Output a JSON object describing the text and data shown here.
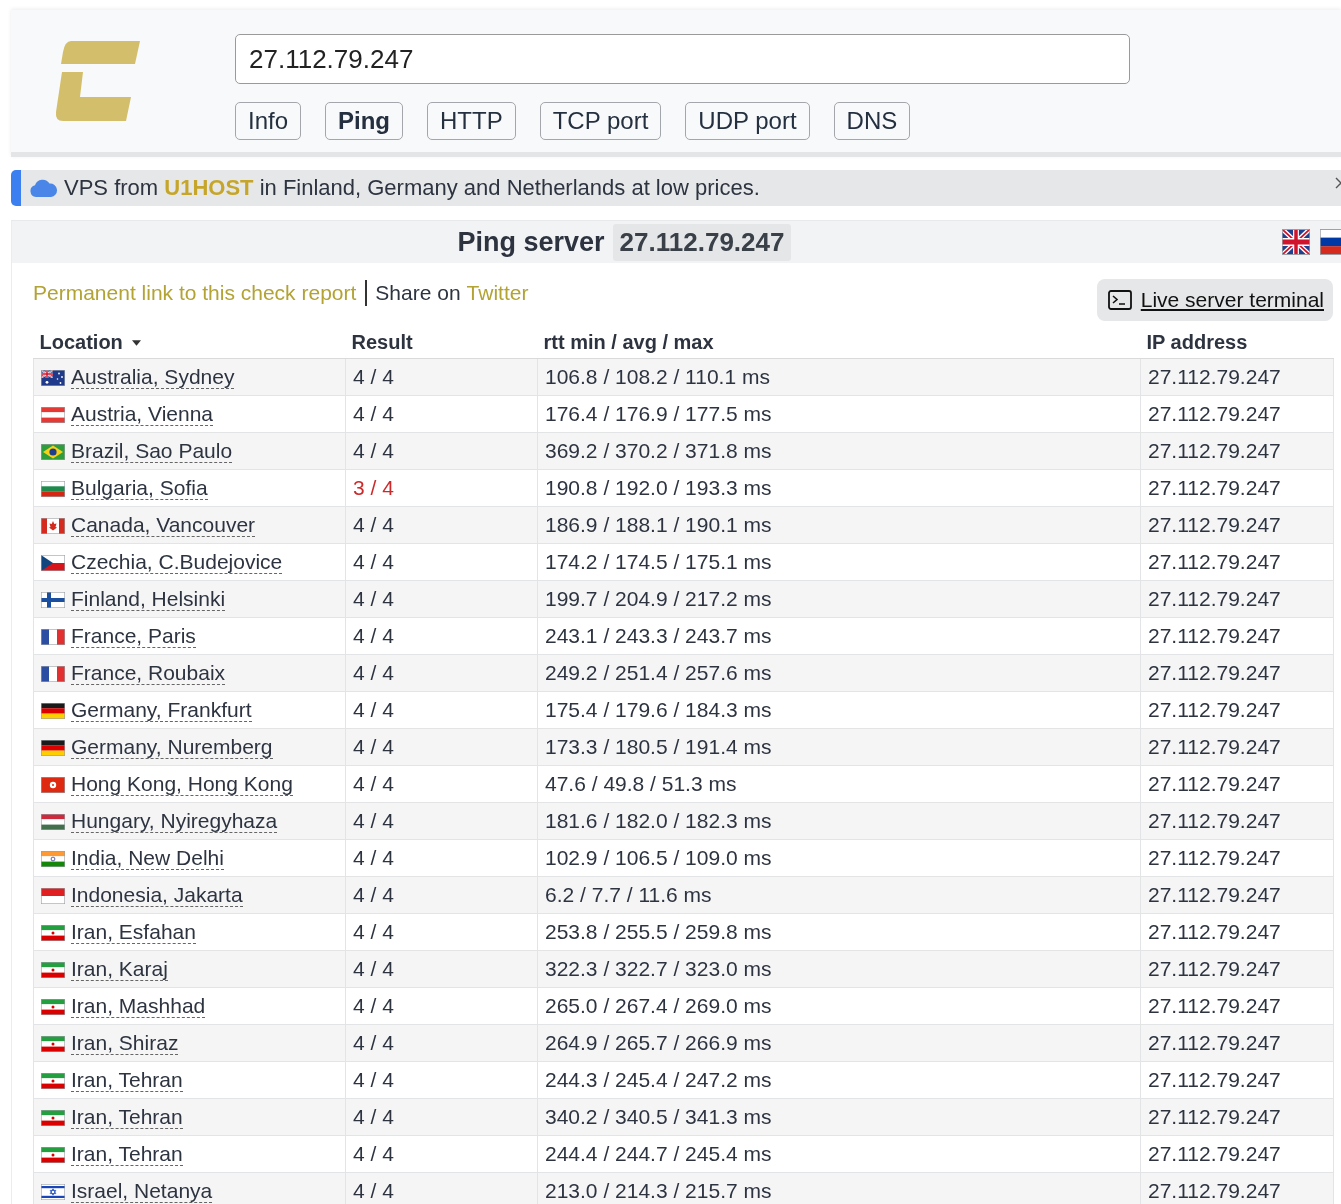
{
  "search": {
    "value": "27.112.79.247"
  },
  "tabs": [
    {
      "label": "Info",
      "selected": false
    },
    {
      "label": "Ping",
      "selected": true
    },
    {
      "label": "HTTP",
      "selected": false
    },
    {
      "label": "TCP port",
      "selected": false
    },
    {
      "label": "UDP port",
      "selected": false
    },
    {
      "label": "DNS",
      "selected": false
    }
  ],
  "banner": {
    "text_before": "VPS from",
    "link": "U1HOST",
    "text_after": "in Finland, Germany and Netherlands at low prices."
  },
  "panel": {
    "title": "Ping server",
    "host": "27.112.79.247",
    "languages": [
      {
        "kind": "britain"
      },
      {
        "kind": "russia"
      }
    ]
  },
  "links": {
    "permalink": "Permanent link to this check report",
    "share_label": "Share on",
    "share_link": "Twitter",
    "terminal_button": "Live server terminal"
  },
  "table": {
    "columns": [
      {
        "label": "Location",
        "sorted": true
      },
      {
        "label": "Result",
        "sorted": false
      },
      {
        "label": "rtt min / avg / max",
        "sorted": false
      },
      {
        "label": "IP address",
        "sorted": false
      }
    ],
    "rows": [
      {
        "kind": "australia",
        "location": "Australia, Sydney",
        "result": "4 / 4",
        "loss": false,
        "rtt": "106.8 / 108.2 / 110.1 ms",
        "ip": "27.112.79.247"
      },
      {
        "kind": "austria",
        "location": "Austria, Vienna",
        "result": "4 / 4",
        "loss": false,
        "rtt": "176.4 / 176.9 / 177.5 ms",
        "ip": "27.112.79.247"
      },
      {
        "kind": "brazil",
        "location": "Brazil, Sao Paulo",
        "result": "4 / 4",
        "loss": false,
        "rtt": "369.2 / 370.2 / 371.8 ms",
        "ip": "27.112.79.247"
      },
      {
        "kind": "bulgaria",
        "location": "Bulgaria, Sofia",
        "result": "3 / 4",
        "loss": true,
        "rtt": "190.8 / 192.0 / 193.3 ms",
        "ip": "27.112.79.247"
      },
      {
        "kind": "canada",
        "location": "Canada, Vancouver",
        "result": "4 / 4",
        "loss": false,
        "rtt": "186.9 / 188.1 / 190.1 ms",
        "ip": "27.112.79.247"
      },
      {
        "kind": "czechia",
        "location": "Czechia, C.Budejovice",
        "result": "4 / 4",
        "loss": false,
        "rtt": "174.2 / 174.5 / 175.1 ms",
        "ip": "27.112.79.247"
      },
      {
        "kind": "finland",
        "location": "Finland, Helsinki",
        "result": "4 / 4",
        "loss": false,
        "rtt": "199.7 / 204.9 / 217.2 ms",
        "ip": "27.112.79.247"
      },
      {
        "kind": "france",
        "location": "France, Paris",
        "result": "4 / 4",
        "loss": false,
        "rtt": "243.1 / 243.3 / 243.7 ms",
        "ip": "27.112.79.247"
      },
      {
        "kind": "france",
        "location": "France, Roubaix",
        "result": "4 / 4",
        "loss": false,
        "rtt": "249.2 / 251.4 / 257.6 ms",
        "ip": "27.112.79.247"
      },
      {
        "kind": "germany",
        "location": "Germany, Frankfurt",
        "result": "4 / 4",
        "loss": false,
        "rtt": "175.4 / 179.6 / 184.3 ms",
        "ip": "27.112.79.247"
      },
      {
        "kind": "germany",
        "location": "Germany, Nuremberg",
        "result": "4 / 4",
        "loss": false,
        "rtt": "173.3 / 180.5 / 191.4 ms",
        "ip": "27.112.79.247"
      },
      {
        "kind": "hongkong",
        "location": "Hong Kong, Hong Kong",
        "result": "4 / 4",
        "loss": false,
        "rtt": "47.6 / 49.8 / 51.3 ms",
        "ip": "27.112.79.247"
      },
      {
        "kind": "hungary",
        "location": "Hungary, Nyiregyhaza",
        "result": "4 / 4",
        "loss": false,
        "rtt": "181.6 / 182.0 / 182.3 ms",
        "ip": "27.112.79.247"
      },
      {
        "kind": "india",
        "location": "India, New Delhi",
        "result": "4 / 4",
        "loss": false,
        "rtt": "102.9 / 106.5 / 109.0 ms",
        "ip": "27.112.79.247"
      },
      {
        "kind": "indonesia",
        "location": "Indonesia, Jakarta",
        "result": "4 / 4",
        "loss": false,
        "rtt": "6.2 / 7.7 / 11.6 ms",
        "ip": "27.112.79.247"
      },
      {
        "kind": "iran",
        "location": "Iran, Esfahan",
        "result": "4 / 4",
        "loss": false,
        "rtt": "253.8 / 255.5 / 259.8 ms",
        "ip": "27.112.79.247"
      },
      {
        "kind": "iran",
        "location": "Iran, Karaj",
        "result": "4 / 4",
        "loss": false,
        "rtt": "322.3 / 322.7 / 323.0 ms",
        "ip": "27.112.79.247"
      },
      {
        "kind": "iran",
        "location": "Iran, Mashhad",
        "result": "4 / 4",
        "loss": false,
        "rtt": "265.0 / 267.4 / 269.0 ms",
        "ip": "27.112.79.247"
      },
      {
        "kind": "iran",
        "location": "Iran, Shiraz",
        "result": "4 / 4",
        "loss": false,
        "rtt": "264.9 / 265.7 / 266.9 ms",
        "ip": "27.112.79.247"
      },
      {
        "kind": "iran",
        "location": "Iran, Tehran",
        "result": "4 / 4",
        "loss": false,
        "rtt": "244.3 / 245.4 / 247.2 ms",
        "ip": "27.112.79.247"
      },
      {
        "kind": "iran",
        "location": "Iran, Tehran",
        "result": "4 / 4",
        "loss": false,
        "rtt": "340.2 / 340.5 / 341.3 ms",
        "ip": "27.112.79.247"
      },
      {
        "kind": "iran",
        "location": "Iran, Tehran",
        "result": "4 / 4",
        "loss": false,
        "rtt": "244.4 / 244.7 / 245.4 ms",
        "ip": "27.112.79.247"
      },
      {
        "kind": "israel",
        "location": "Israel, Netanya",
        "result": "4 / 4",
        "loss": false,
        "rtt": "213.0 / 214.3 / 215.7 ms",
        "ip": "27.112.79.247"
      }
    ]
  }
}
